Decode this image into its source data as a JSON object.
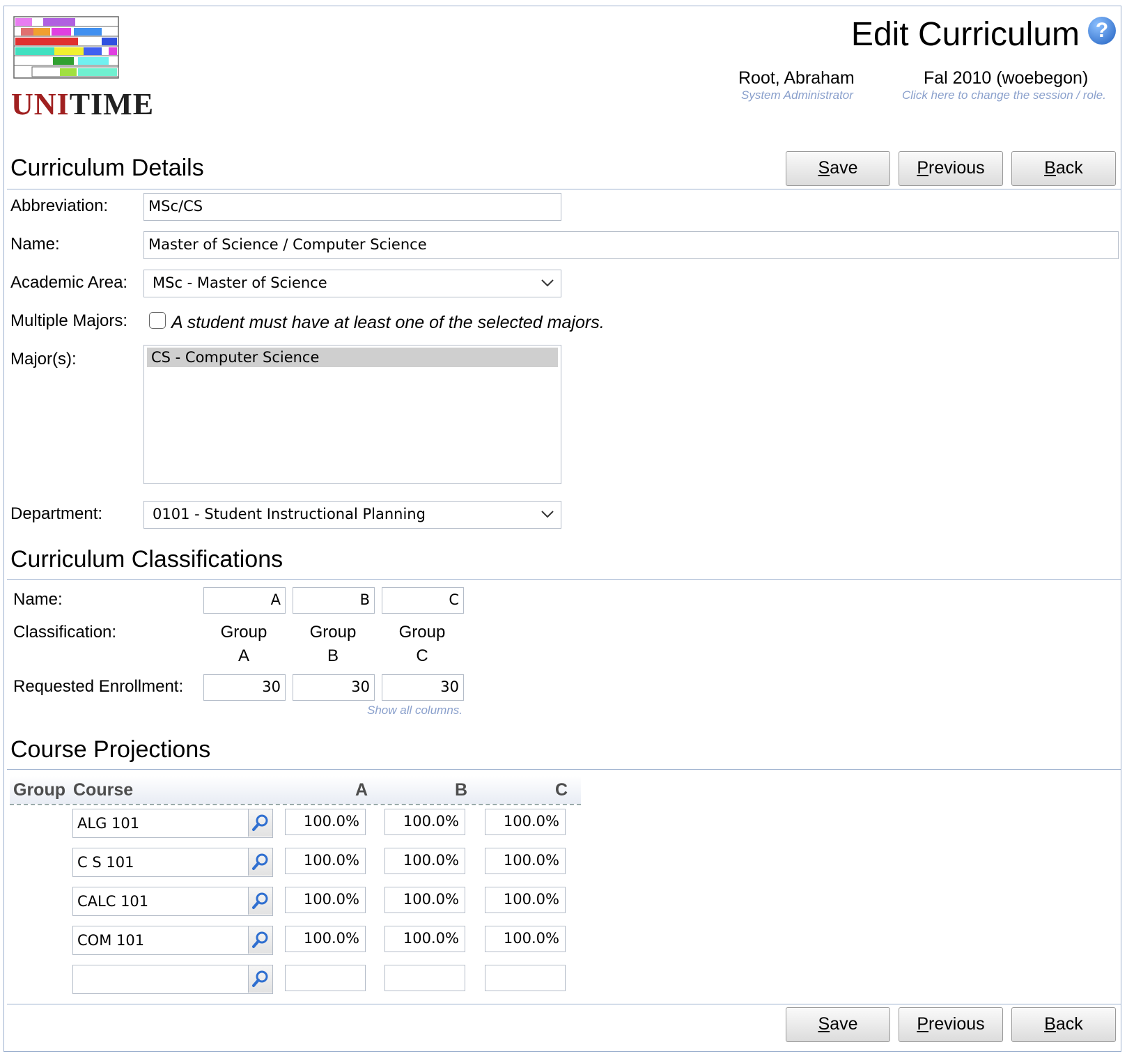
{
  "header": {
    "page_title": "Edit Curriculum",
    "user_name": "Root, Abraham",
    "user_role": "System Administrator",
    "session_name": "Fal 2010 (woebegon)",
    "session_hint": "Click here to change the session / role."
  },
  "buttons": {
    "save": "ave",
    "save_key": "S",
    "previous": "revious",
    "previous_key": "P",
    "back": "ack",
    "back_key": "B"
  },
  "details": {
    "title": "Curriculum Details",
    "abbreviation_label": "Abbreviation:",
    "abbreviation_value": "MSc/CS",
    "name_label": "Name:",
    "name_value": "Master of Science / Computer Science",
    "area_label": "Academic Area:",
    "area_value": "MSc - Master of Science",
    "multiple_majors_label": "Multiple Majors:",
    "multiple_majors_text": "A student must have at least one of the selected majors.",
    "majors_label": "Major(s):",
    "majors": [
      "CS - Computer Science"
    ],
    "department_label": "Department:",
    "department_value": "0101 - Student Instructional Planning"
  },
  "classifications": {
    "title": "Curriculum Classifications",
    "name_label": "Name:",
    "classification_label": "Classification:",
    "enrollment_label": "Requested Enrollment:",
    "columns": [
      {
        "name": "A",
        "group": "Group",
        "group_code": "A",
        "enrollment": "30"
      },
      {
        "name": "B",
        "group": "Group",
        "group_code": "B",
        "enrollment": "30"
      },
      {
        "name": "C",
        "group": "Group",
        "group_code": "C",
        "enrollment": "30"
      }
    ],
    "show_all": "Show all columns."
  },
  "projections": {
    "title": "Course Projections",
    "header_group": "Group",
    "header_course": "Course",
    "headers": [
      "A",
      "B",
      "C"
    ],
    "rows": [
      {
        "course": "ALG 101",
        "values": [
          "100.0%",
          "100.0%",
          "100.0%"
        ]
      },
      {
        "course": "C S 101",
        "values": [
          "100.0%",
          "100.0%",
          "100.0%"
        ]
      },
      {
        "course": "CALC 101",
        "values": [
          "100.0%",
          "100.0%",
          "100.0%"
        ]
      },
      {
        "course": "COM 101",
        "values": [
          "100.0%",
          "100.0%",
          "100.0%"
        ]
      },
      {
        "course": "",
        "values": [
          "",
          "",
          ""
        ]
      }
    ]
  },
  "logo": {
    "text_uni": "UNI",
    "text_time": "TIME"
  }
}
